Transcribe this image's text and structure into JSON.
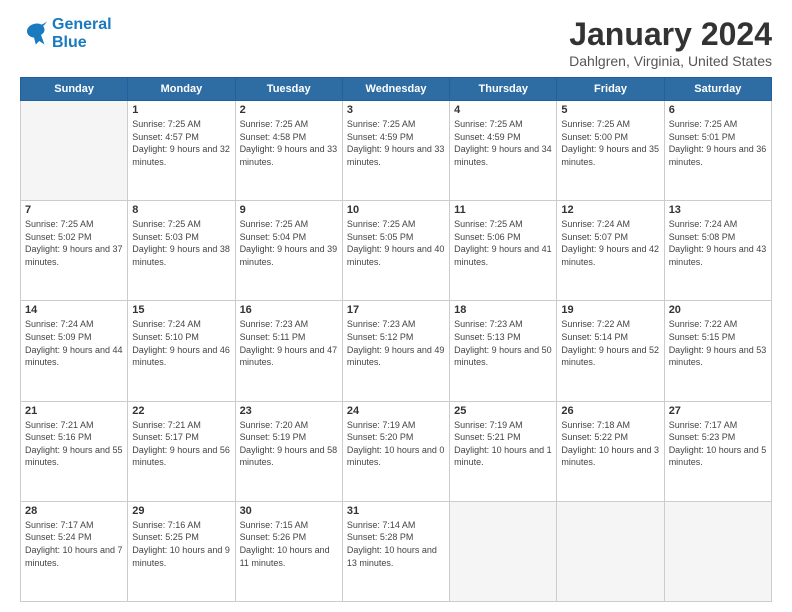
{
  "logo": {
    "line1": "General",
    "line2": "Blue"
  },
  "title": "January 2024",
  "subtitle": "Dahlgren, Virginia, United States",
  "days_header": [
    "Sunday",
    "Monday",
    "Tuesday",
    "Wednesday",
    "Thursday",
    "Friday",
    "Saturday"
  ],
  "weeks": [
    [
      {
        "day": "",
        "empty": true
      },
      {
        "day": "1",
        "rise": "7:25 AM",
        "set": "4:57 PM",
        "daylight": "9 hours and 32 minutes."
      },
      {
        "day": "2",
        "rise": "7:25 AM",
        "set": "4:58 PM",
        "daylight": "9 hours and 33 minutes."
      },
      {
        "day": "3",
        "rise": "7:25 AM",
        "set": "4:59 PM",
        "daylight": "9 hours and 33 minutes."
      },
      {
        "day": "4",
        "rise": "7:25 AM",
        "set": "4:59 PM",
        "daylight": "9 hours and 34 minutes."
      },
      {
        "day": "5",
        "rise": "7:25 AM",
        "set": "5:00 PM",
        "daylight": "9 hours and 35 minutes."
      },
      {
        "day": "6",
        "rise": "7:25 AM",
        "set": "5:01 PM",
        "daylight": "9 hours and 36 minutes."
      }
    ],
    [
      {
        "day": "7",
        "rise": "7:25 AM",
        "set": "5:02 PM",
        "daylight": "9 hours and 37 minutes."
      },
      {
        "day": "8",
        "rise": "7:25 AM",
        "set": "5:03 PM",
        "daylight": "9 hours and 38 minutes."
      },
      {
        "day": "9",
        "rise": "7:25 AM",
        "set": "5:04 PM",
        "daylight": "9 hours and 39 minutes."
      },
      {
        "day": "10",
        "rise": "7:25 AM",
        "set": "5:05 PM",
        "daylight": "9 hours and 40 minutes."
      },
      {
        "day": "11",
        "rise": "7:25 AM",
        "set": "5:06 PM",
        "daylight": "9 hours and 41 minutes."
      },
      {
        "day": "12",
        "rise": "7:24 AM",
        "set": "5:07 PM",
        "daylight": "9 hours and 42 minutes."
      },
      {
        "day": "13",
        "rise": "7:24 AM",
        "set": "5:08 PM",
        "daylight": "9 hours and 43 minutes."
      }
    ],
    [
      {
        "day": "14",
        "rise": "7:24 AM",
        "set": "5:09 PM",
        "daylight": "9 hours and 44 minutes."
      },
      {
        "day": "15",
        "rise": "7:24 AM",
        "set": "5:10 PM",
        "daylight": "9 hours and 46 minutes."
      },
      {
        "day": "16",
        "rise": "7:23 AM",
        "set": "5:11 PM",
        "daylight": "9 hours and 47 minutes."
      },
      {
        "day": "17",
        "rise": "7:23 AM",
        "set": "5:12 PM",
        "daylight": "9 hours and 49 minutes."
      },
      {
        "day": "18",
        "rise": "7:23 AM",
        "set": "5:13 PM",
        "daylight": "9 hours and 50 minutes."
      },
      {
        "day": "19",
        "rise": "7:22 AM",
        "set": "5:14 PM",
        "daylight": "9 hours and 52 minutes."
      },
      {
        "day": "20",
        "rise": "7:22 AM",
        "set": "5:15 PM",
        "daylight": "9 hours and 53 minutes."
      }
    ],
    [
      {
        "day": "21",
        "rise": "7:21 AM",
        "set": "5:16 PM",
        "daylight": "9 hours and 55 minutes."
      },
      {
        "day": "22",
        "rise": "7:21 AM",
        "set": "5:17 PM",
        "daylight": "9 hours and 56 minutes."
      },
      {
        "day": "23",
        "rise": "7:20 AM",
        "set": "5:19 PM",
        "daylight": "9 hours and 58 minutes."
      },
      {
        "day": "24",
        "rise": "7:19 AM",
        "set": "5:20 PM",
        "daylight": "10 hours and 0 minutes."
      },
      {
        "day": "25",
        "rise": "7:19 AM",
        "set": "5:21 PM",
        "daylight": "10 hours and 1 minute."
      },
      {
        "day": "26",
        "rise": "7:18 AM",
        "set": "5:22 PM",
        "daylight": "10 hours and 3 minutes."
      },
      {
        "day": "27",
        "rise": "7:17 AM",
        "set": "5:23 PM",
        "daylight": "10 hours and 5 minutes."
      }
    ],
    [
      {
        "day": "28",
        "rise": "7:17 AM",
        "set": "5:24 PM",
        "daylight": "10 hours and 7 minutes."
      },
      {
        "day": "29",
        "rise": "7:16 AM",
        "set": "5:25 PM",
        "daylight": "10 hours and 9 minutes."
      },
      {
        "day": "30",
        "rise": "7:15 AM",
        "set": "5:26 PM",
        "daylight": "10 hours and 11 minutes."
      },
      {
        "day": "31",
        "rise": "7:14 AM",
        "set": "5:28 PM",
        "daylight": "10 hours and 13 minutes."
      },
      {
        "day": "",
        "empty": true
      },
      {
        "day": "",
        "empty": true
      },
      {
        "day": "",
        "empty": true
      }
    ]
  ]
}
